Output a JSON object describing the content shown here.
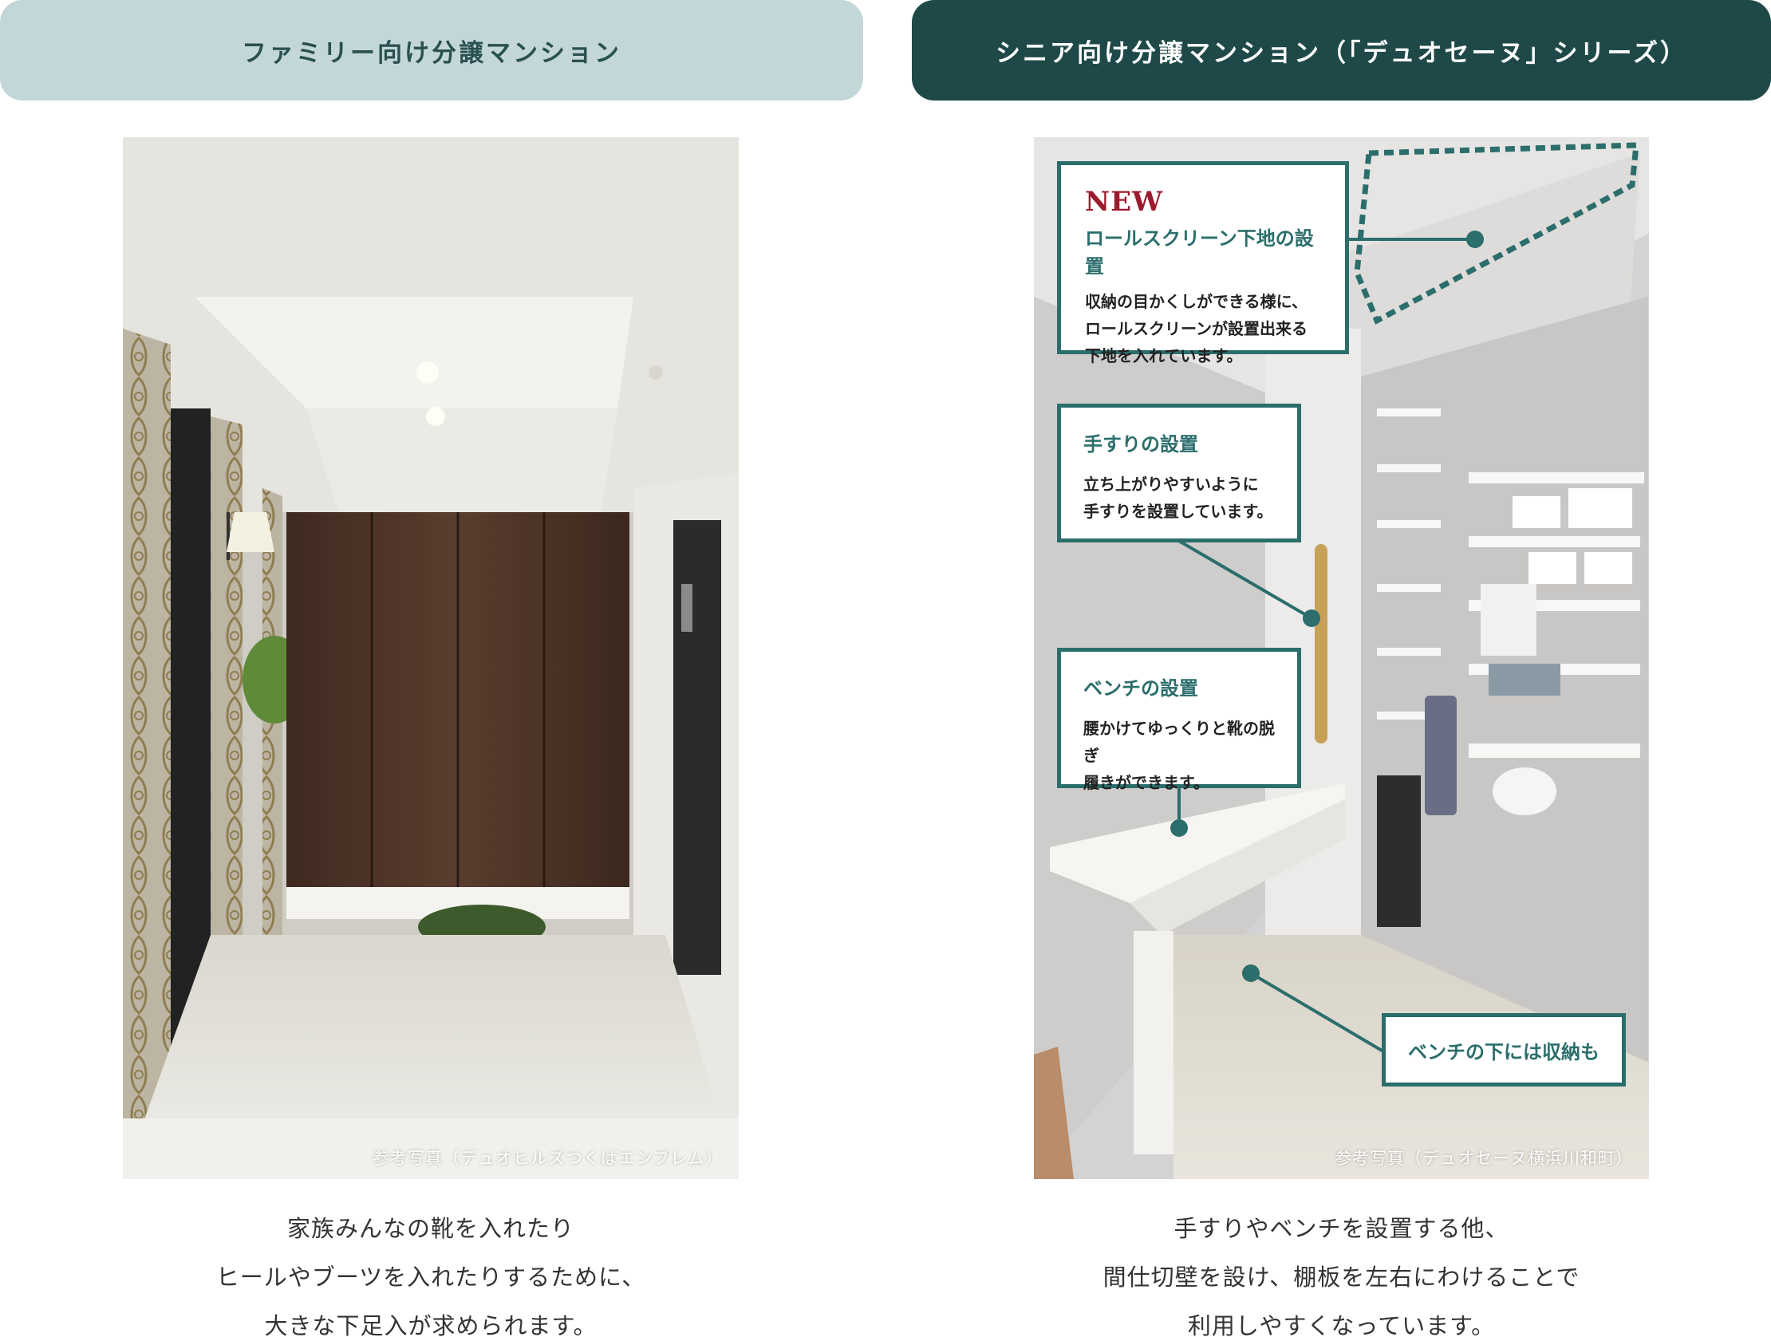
{
  "tabs": {
    "family": "ファミリー向け分譲マンション",
    "senior": "シニア向け分譲マンション（「デュオセーヌ」シリーズ）"
  },
  "left_photo": {
    "credit": "参考写真（デュオヒルズつくばエンブレム）"
  },
  "right_photo": {
    "credit": "参考写真（デュオセーヌ横浜川和町）",
    "callouts": {
      "roll_screen": {
        "badge": "NEW",
        "title": "ロールスクリーン下地の設置",
        "lines": [
          "収納の目かくしができる様に、",
          "ロールスクリーンが設置出来る",
          "下地を入れています。"
        ]
      },
      "handrail": {
        "title": "手すりの設置",
        "lines": [
          "立ち上がりやすいように",
          "手すりを設置しています。"
        ]
      },
      "bench": {
        "title": "ベンチの設置",
        "lines": [
          "腰かけてゆっくりと靴の脱ぎ",
          "履きができます。"
        ]
      },
      "under_bench": {
        "title": "ベンチの下には収納も"
      }
    }
  },
  "captions": {
    "left": [
      "家族みんなの靴を入れたり",
      "ヒールやブーツを入れたりするために、",
      "大きな下足入が求められます。"
    ],
    "right": [
      "手すりやベンチを設置する他、",
      "間仕切壁を設け、棚板を左右にわけることで",
      "利用しやすくなっています。"
    ]
  },
  "colors": {
    "tab_family_bg": "#c3d7d9",
    "tab_senior_bg": "#1f4949",
    "accent_teal": "#2b6e6c",
    "new_badge": "#9b1b2e"
  }
}
